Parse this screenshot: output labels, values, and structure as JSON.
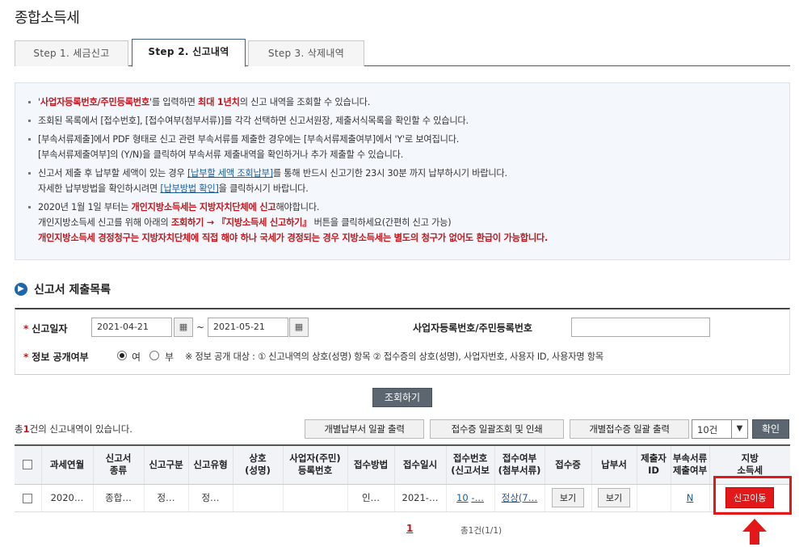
{
  "page": {
    "title": "종합소득세"
  },
  "tabs": [
    {
      "label": "Step 1. 세금신고"
    },
    {
      "label": "Step 2. 신고내역"
    },
    {
      "label": "Step 3. 삭제내역"
    }
  ],
  "info": {
    "l1_a": "'",
    "l1_b": "사업자등록번호/주민등록번호",
    "l1_c": "'를 입력하면 ",
    "l1_d": "최대 1년치",
    "l1_e": "의 신고 내역을 조회할 수 있습니다.",
    "l2": "조회된 목록에서 [접수번호], [접수여부(첨부서류)]를 각각 선택하면 신고서원장, 제출서식목록을 확인할 수 있습니다.",
    "l3": "[부속서류제출]에서 PDF 형태로 신고 관련 부속서류를 제출한 경우에는 [부속서류제출여부]에서 'Y'로 보여집니다.",
    "l4": "[부속서류제출여부]의 (Y/N)을 클릭하여 부속서류 제출내역을 확인하거나 추가 제출할 수 있습니다.",
    "l5_a": "신고서 제출 후 납부할 세액이 있는 경우 ",
    "l5_b": "[납부할 세액 조회납부]",
    "l5_c": "를 통해 반드시 신고기한 23시 30분 까지 납부하시기 바랍니다.",
    "l6_a": "자세한 납부방법을 확인하시려면 ",
    "l6_b": "[납부방법 확인]",
    "l6_c": "을 클릭하시기 바랍니다.",
    "l7_a": "2020년 1월 1일 부터는 ",
    "l7_b": "개인지방소득세는 지방자치단체에 신고",
    "l7_c": "해야합니다.",
    "l8_a": "개인지방소득세 신고를 위해 아래의 ",
    "l8_b": "조회하기 → 『지방소득세 신고하기』",
    "l8_c": " 버튼을 클릭하세요(간편히 신고 가능)",
    "l9": "개인지방소득세 경정청구는 지방자치단체에 직접 해야 하나 국세가 경정되는 경우 지방소득세는 별도의 청구가 없어도 환급이 가능합니다."
  },
  "section": {
    "title": "신고서 제출목록"
  },
  "search": {
    "date_label": "신고일자",
    "date_from": "2021-04-21",
    "date_to": "2021-05-21",
    "tilde": "~",
    "id_label": "사업자등록번호/주민등록번호",
    "id_value": "",
    "public_label": "정보 공개여부",
    "opt_yes": "여",
    "opt_no": "부",
    "note": "※ 정보 공개 대상 : ① 신고내역의 상호(성명) 항목 ② 접수증의 상호(성명), 사업자번호, 사용자 ID, 사용자명 항목",
    "search_button": "조회하기"
  },
  "results": {
    "count_pre": "총",
    "count_num": "1",
    "count_post": "건의 신고내역이 있습니다.",
    "btn_bulk_payment": "개별납부서 일괄 출력",
    "btn_bulk_receipt_view": "접수증 일괄조회 및 인쇄",
    "btn_bulk_receipt_print": "개별접수증 일괄 출력",
    "page_size": "10건",
    "btn_confirm": "확인"
  },
  "table": {
    "headers": {
      "h1": "과세연월",
      "h2a": "신고서",
      "h2b": "종류",
      "h3": "신고구분",
      "h4": "신고유형",
      "h5a": "상호",
      "h5b": "(성명)",
      "h6a": "사업자(주민)",
      "h6b": "등록번호",
      "h7": "접수방법",
      "h8": "접수일시",
      "h9a": "접수번호",
      "h9b": "(신고서보",
      "h10a": "접수여부",
      "h10b": "(첨부서류)",
      "h11": "접수증",
      "h12": "납부서",
      "h13a": "제출자",
      "h13b": "ID",
      "h14a": "부속서류",
      "h14b": "제출여부",
      "h15a": "지방",
      "h15b": "소득세"
    },
    "row": {
      "period": "2020…",
      "type": "종합…",
      "category": "정…",
      "kind": "정…",
      "name": "",
      "reg_no": "",
      "method": "인…",
      "received_at": "2021-…",
      "receipt_no_a": "10",
      "receipt_no_b": "-…",
      "status": "정상(7…",
      "receipt_btn": "보기",
      "payment_btn": "보기",
      "submitter": "",
      "attach": "N",
      "local_tax_btn": "신고이동"
    }
  },
  "pager": {
    "current": "1",
    "info": "총1건(1/1)"
  }
}
